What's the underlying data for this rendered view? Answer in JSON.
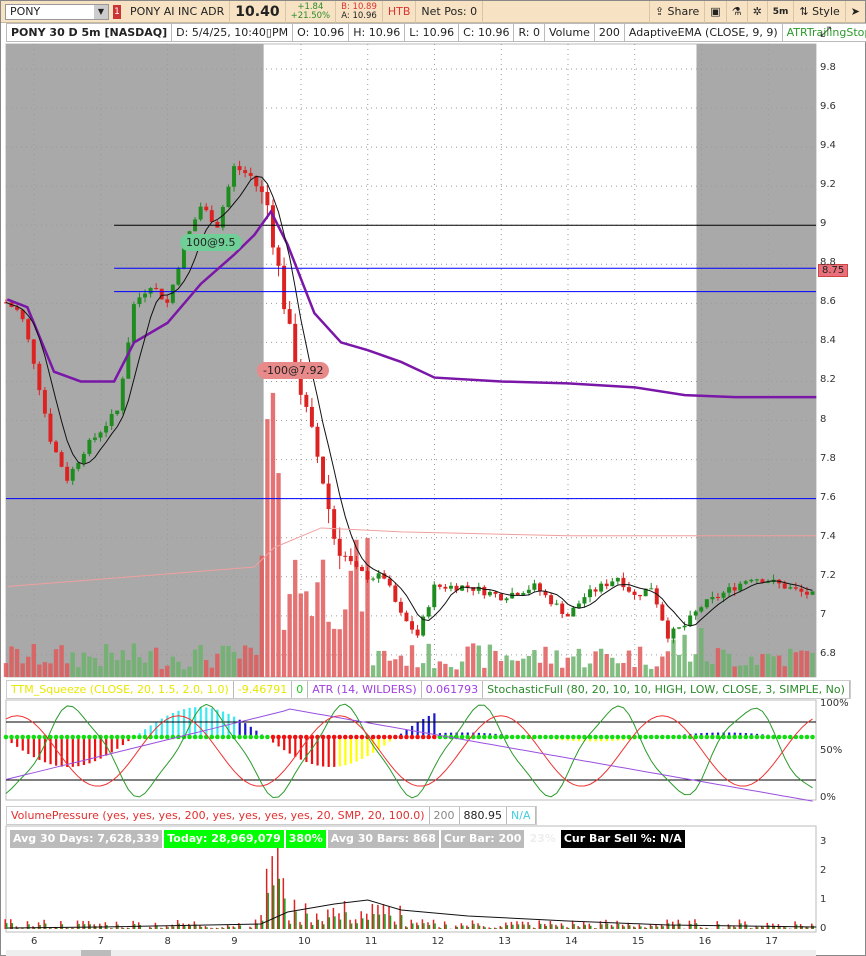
{
  "toolbar": {
    "symbol": "PONY",
    "alert_badge": "1",
    "company": "PONY AI INC ADR",
    "last": "10.40",
    "change": "+1.84",
    "change_pct": "+21.50%",
    "bid": "B: 10.89",
    "ask": "A: 10.96",
    "htb": "HTB",
    "net_pos": "Net Pos: 0",
    "share": "Share",
    "timeframe": "5m",
    "style": "Style"
  },
  "info": {
    "title": "PONY 30 D 5m [NASDAQ]",
    "date": "D: 5/4/25, 10:40▯PM",
    "open": "O: 10.96",
    "high": "H: 10.96",
    "low": "L: 10.96",
    "close": "C: 10.96",
    "range": "R: 0",
    "volume_label": "Volume",
    "volume_value": "200",
    "ema_label": "AdaptiveEMA (CLOSE, 9, 9)",
    "atr_stop": "ATRTrailingStop ..."
  },
  "orders": [
    {
      "label": "100@9.5",
      "color": "#6fcf97"
    },
    {
      "label": "-100@7.92",
      "color": "#e98a8a"
    }
  ],
  "price_badge": "8.75",
  "study1": {
    "squeeze": "TTM_Squeeze (CLOSE, 20, 1.5, 2.0, 1.0)",
    "squeeze_val": "-9.46791",
    "squeeze_zero": "0",
    "atr": "ATR (14, WILDERS)",
    "atr_val": "0.061793",
    "stoch": "StochasticFull (80, 20, 10, 10, HIGH, LOW, CLOSE, 3, SIMPLE, No)",
    "axis": [
      "100%",
      "50%",
      "0%"
    ]
  },
  "study2": {
    "vp": "VolumePressure (yes, yes, yes, 200, yes, yes, yes, yes, 20, SMP, 20, 100.0)",
    "v1": "200",
    "v2": "880.95",
    "v3": "N/A",
    "avg30": "Avg 30 Days: 7,628,339",
    "today": "Today: 28,969,079",
    "pct": "380%",
    "avgbars": "Avg 30 Bars: 868",
    "curbar": "Cur Bar: 200",
    "faint": "23%",
    "sell": "Cur Bar Sell %: N/A",
    "axis": [
      "3",
      "2",
      "1",
      "0"
    ]
  },
  "chart_data": {
    "type": "candlestick",
    "price_axis": [
      "9.8",
      "9.6",
      "9.4",
      "9.2",
      "9",
      "8.8",
      "8.6",
      "8.4",
      "8.2",
      "8",
      "7.8",
      "7.6",
      "7.4",
      "7.2",
      "7",
      "6.8"
    ],
    "ylim": [
      6.8,
      9.8
    ],
    "time_axis": [
      "6",
      "7",
      "8",
      "9",
      "10",
      "11",
      "12",
      "13",
      "14",
      "15",
      "16",
      "17"
    ],
    "xlim_hours": [
      5.58,
      17.72
    ],
    "session": {
      "premarket_end": 9.5,
      "aftermarket_start": 16.0
    },
    "price_path": [
      [
        5.6,
        8.6
      ],
      [
        5.8,
        8.55
      ],
      [
        6.0,
        8.3
      ],
      [
        6.25,
        7.9
      ],
      [
        6.5,
        7.7
      ],
      [
        6.75,
        7.85
      ],
      [
        7.0,
        7.95
      ],
      [
        7.25,
        8.05
      ],
      [
        7.5,
        8.6
      ],
      [
        7.75,
        8.7
      ],
      [
        8.0,
        8.6
      ],
      [
        8.25,
        8.9
      ],
      [
        8.5,
        9.1
      ],
      [
        8.75,
        9.0
      ],
      [
        9.0,
        9.3
      ],
      [
        9.25,
        9.25
      ],
      [
        9.5,
        9.1
      ],
      [
        9.6,
        8.9
      ],
      [
        9.75,
        8.6
      ],
      [
        9.9,
        8.3
      ],
      [
        10.1,
        8.0
      ],
      [
        10.3,
        7.75
      ],
      [
        10.5,
        7.4
      ],
      [
        10.75,
        7.25
      ],
      [
        11.0,
        7.2
      ],
      [
        11.25,
        7.2
      ],
      [
        11.5,
        7.0
      ],
      [
        11.75,
        6.9
      ],
      [
        12.0,
        7.15
      ],
      [
        12.5,
        7.15
      ],
      [
        13.0,
        7.1
      ],
      [
        13.5,
        7.15
      ],
      [
        14.0,
        7.0
      ],
      [
        14.25,
        7.1
      ],
      [
        14.5,
        7.15
      ],
      [
        14.75,
        7.2
      ],
      [
        15.0,
        7.1
      ],
      [
        15.25,
        7.15
      ],
      [
        15.5,
        6.9
      ],
      [
        15.75,
        6.95
      ],
      [
        16.0,
        7.05
      ],
      [
        16.25,
        7.1
      ],
      [
        16.5,
        7.15
      ],
      [
        16.75,
        7.2
      ],
      [
        17.0,
        7.18
      ],
      [
        17.25,
        7.15
      ],
      [
        17.5,
        7.12
      ],
      [
        17.72,
        7.1
      ]
    ],
    "ema_path": [
      [
        5.6,
        8.62
      ],
      [
        5.9,
        8.58
      ],
      [
        6.3,
        8.25
      ],
      [
        6.7,
        8.2
      ],
      [
        7.2,
        8.2
      ],
      [
        7.5,
        8.4
      ],
      [
        8.0,
        8.5
      ],
      [
        8.5,
        8.7
      ],
      [
        9.0,
        8.85
      ],
      [
        9.3,
        8.95
      ],
      [
        9.55,
        9.07
      ],
      [
        9.8,
        8.9
      ],
      [
        10.2,
        8.55
      ],
      [
        10.6,
        8.4
      ],
      [
        11.0,
        8.36
      ],
      [
        11.5,
        8.3
      ],
      [
        12.0,
        8.22
      ],
      [
        13.0,
        8.2
      ],
      [
        14.0,
        8.19
      ],
      [
        15.0,
        8.17
      ],
      [
        15.75,
        8.13
      ],
      [
        16.5,
        8.12
      ],
      [
        17.72,
        8.12
      ]
    ],
    "levels": [
      {
        "price": 9.0,
        "color": "#000000",
        "from": 7.2
      },
      {
        "price": 8.78,
        "color": "#0000ff",
        "from": 7.2
      },
      {
        "price": 8.66,
        "color": "#0000ff",
        "from": 7.2
      },
      {
        "price": 7.6,
        "color": "#0000ff",
        "from": 5.58
      }
    ]
  }
}
